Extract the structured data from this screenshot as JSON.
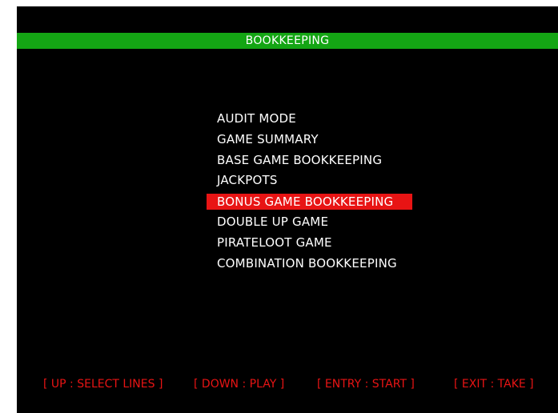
{
  "header": {
    "title": "BOOKKEEPING"
  },
  "menu": {
    "items": [
      {
        "label": "AUDIT MODE"
      },
      {
        "label": "GAME SUMMARY"
      },
      {
        "label": "BASE GAME BOOKKEEPING"
      },
      {
        "label": "JACKPOTS"
      },
      {
        "label": "BONUS GAME BOOKKEEPING"
      },
      {
        "label": "DOUBLE UP GAME"
      },
      {
        "label": "PIRATELOOT GAME"
      },
      {
        "label": "COMBINATION BOOKKEEPING"
      }
    ],
    "selected_index": 4
  },
  "footer": {
    "up": "[ UP : SELECT LINES ]",
    "down": "[ DOWN : PLAY ]",
    "entry": "[ ENTRY : START ]",
    "exit": "[ EXIT : TAKE ]"
  },
  "colors": {
    "background": "#000000",
    "title_bar": "#14a514",
    "highlight": "#e81414",
    "text": "#ffffff",
    "footer_text": "#e81414"
  }
}
